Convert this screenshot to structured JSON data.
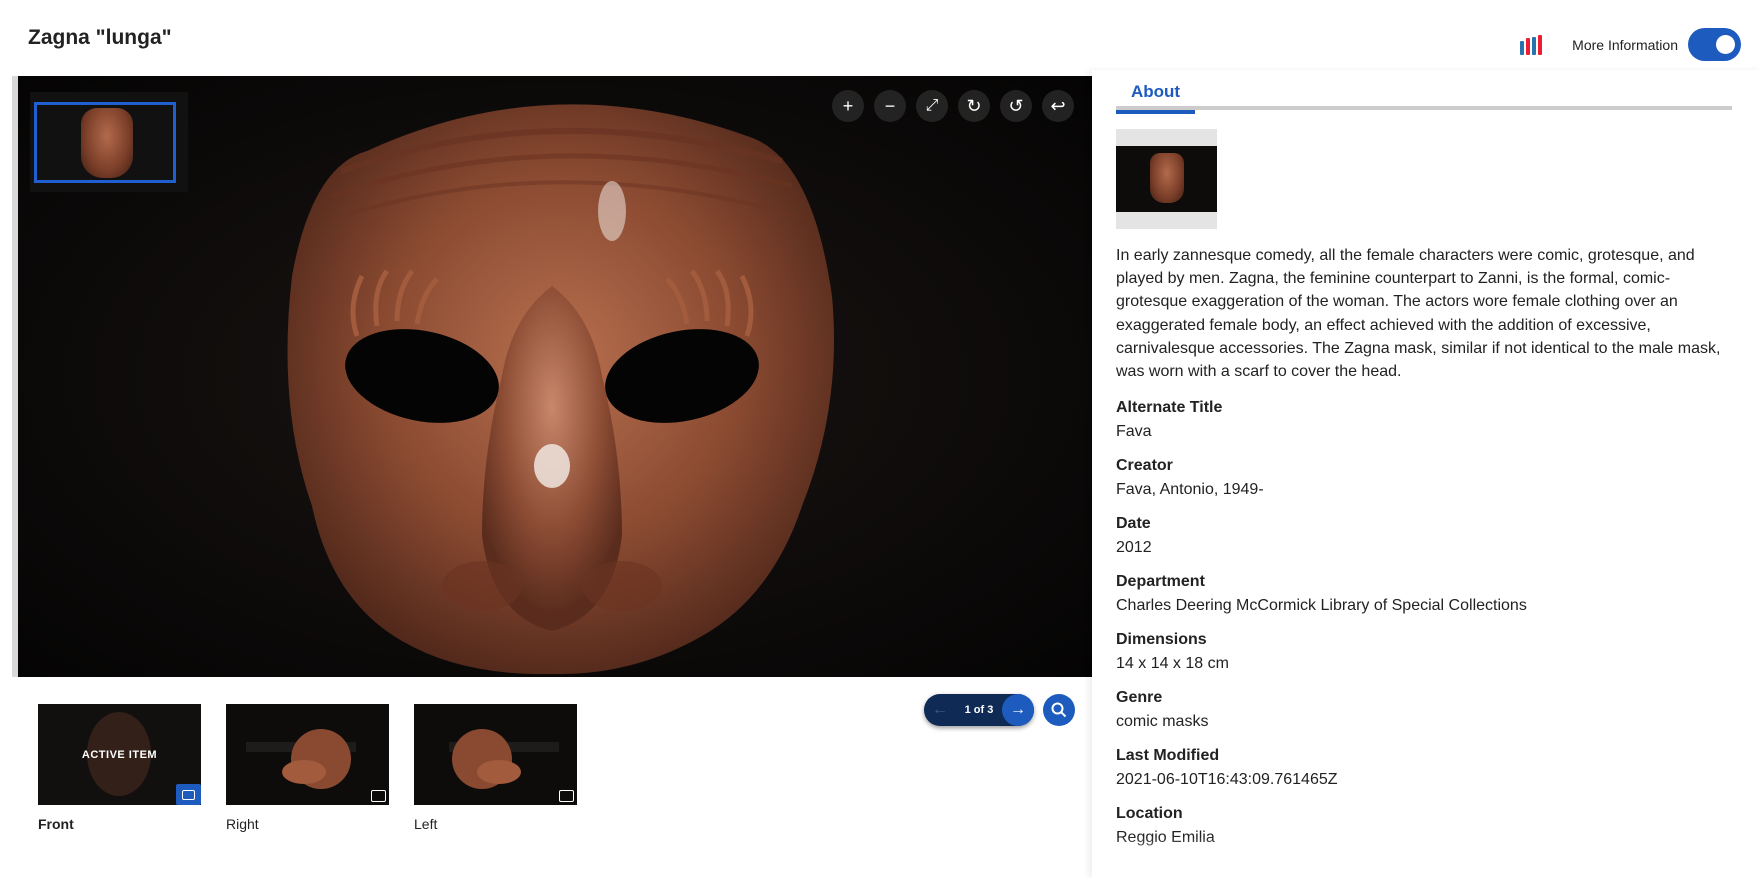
{
  "page": {
    "title": "Zagna \"lunga\""
  },
  "topbar": {
    "iiif_icon": "iiif-logo-icon",
    "more_info_label": "More Information",
    "more_info_enabled": true,
    "colors": {
      "accent": "#1d5bbf"
    }
  },
  "viewer": {
    "controls": [
      {
        "name": "zoom-in-button",
        "glyph": "+"
      },
      {
        "name": "zoom-out-button",
        "glyph": "−"
      },
      {
        "name": "fullscreen-button",
        "glyph": "⤢"
      },
      {
        "name": "rotate-right-button",
        "glyph": "↻"
      },
      {
        "name": "rotate-left-button",
        "glyph": "↺"
      },
      {
        "name": "reset-button",
        "glyph": "↩"
      }
    ]
  },
  "thumbnails": [
    {
      "label": "Front",
      "active": true,
      "overlay": "ACTIVE ITEM"
    },
    {
      "label": "Right",
      "active": false
    },
    {
      "label": "Left",
      "active": false
    }
  ],
  "pager": {
    "count_label": "1 of 3"
  },
  "panel": {
    "tab_label": "About",
    "description": "In early zannesque comedy, all the female characters were comic, grotesque, and played by men. Zagna, the feminine counterpart to Zanni, is the formal, comic-grotesque exaggeration of the woman. The actors wore female clothing over an exaggerated female body, an effect achieved with the addition of excessive, carnivalesque accessories. The Zagna mask, similar if not identical to the male mask, was worn with a scarf to cover the head.",
    "metadata": [
      {
        "key": "Alternate Title",
        "value": "Fava"
      },
      {
        "key": "Creator",
        "value": "Fava, Antonio, 1949-"
      },
      {
        "key": "Date",
        "value": "2012"
      },
      {
        "key": "Department",
        "value": "Charles Deering McCormick Library of Special Collections"
      },
      {
        "key": "Dimensions",
        "value": "14 x 14 x 18 cm"
      },
      {
        "key": "Genre",
        "value": "comic masks"
      },
      {
        "key": "Last Modified",
        "value": "2021-06-10T16:43:09.761465Z"
      },
      {
        "key": "Location",
        "value": "Reggio Emilia"
      }
    ]
  }
}
